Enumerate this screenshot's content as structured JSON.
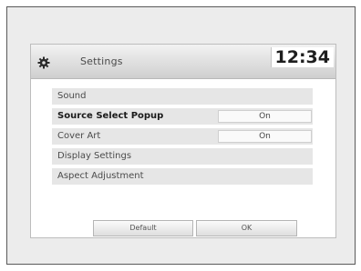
{
  "header": {
    "icon": "gear-icon",
    "title": "Settings",
    "clock": "12:34"
  },
  "menu": {
    "items": [
      {
        "label": "Sound",
        "value": ""
      },
      {
        "label": "Source Select Popup",
        "value": "On"
      },
      {
        "label": "Cover Art",
        "value": "On"
      },
      {
        "label": "Display Settings",
        "value": ""
      },
      {
        "label": "Aspect Adjustment",
        "value": ""
      }
    ]
  },
  "footer": {
    "default_label": "Default",
    "ok_label": "OK"
  }
}
